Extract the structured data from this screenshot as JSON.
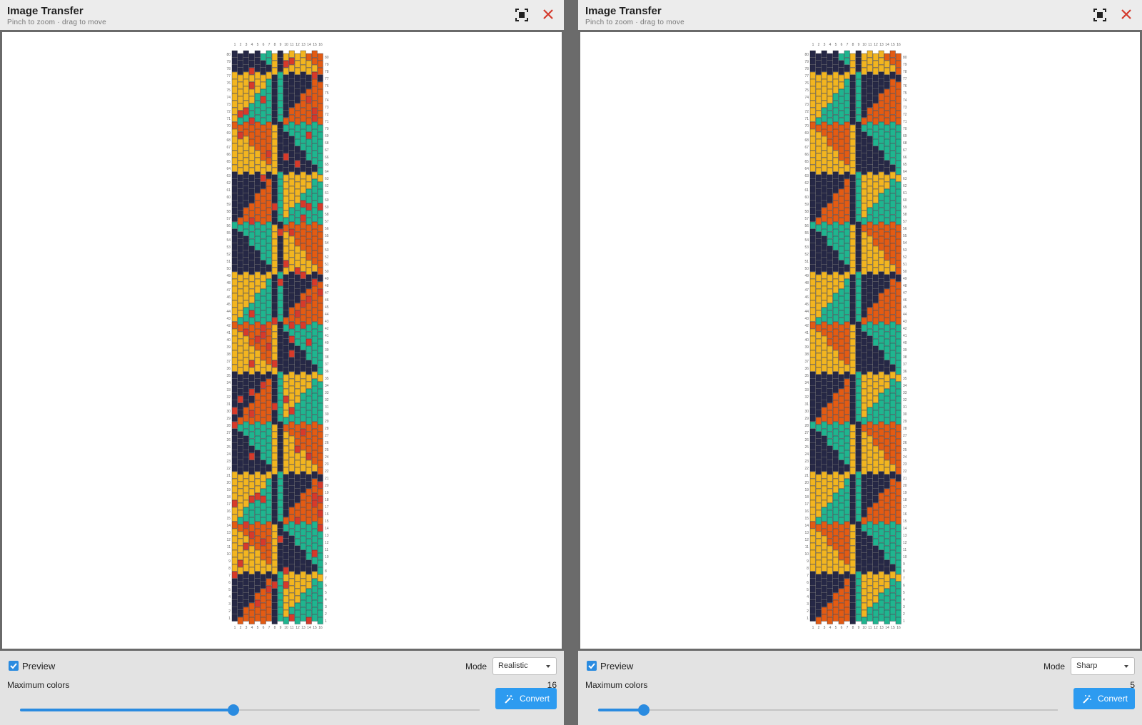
{
  "colors": {
    "navy": "#262846",
    "orange": "#e35b13",
    "yellow": "#f2b520",
    "teal": "#1fb58f",
    "red": "#d73a2a",
    "accent": "#2a8be0",
    "close": "#d43a2d"
  },
  "panels": [
    {
      "window": {
        "title": "Image Transfer",
        "subtitle": "Pinch to zoom · drag to move"
      },
      "icons": {
        "fit": "fit-screen-icon",
        "close": "close-icon",
        "convert": "magic-wand-icon"
      },
      "preview": {
        "checked": true,
        "label": "Preview"
      },
      "mode": {
        "label": "Mode",
        "value": "Realistic"
      },
      "max_colors": {
        "label": "Maximum colors",
        "value": "16",
        "level": 0.465
      },
      "convert_label": "Convert",
      "pattern": {
        "columns": 16,
        "rows": 80,
        "style": "realistic"
      }
    },
    {
      "window": {
        "title": "Image Transfer",
        "subtitle": "Pinch to zoom · drag to move"
      },
      "icons": {
        "fit": "fit-screen-icon",
        "close": "close-icon",
        "convert": "magic-wand-icon"
      },
      "preview": {
        "checked": true,
        "label": "Preview"
      },
      "mode": {
        "label": "Mode",
        "value": "Sharp"
      },
      "max_colors": {
        "label": "Maximum colors",
        "value": "5",
        "level": 0.1
      },
      "convert_label": "Convert",
      "pattern": {
        "columns": 16,
        "rows": 80,
        "style": "sharp"
      }
    }
  ]
}
